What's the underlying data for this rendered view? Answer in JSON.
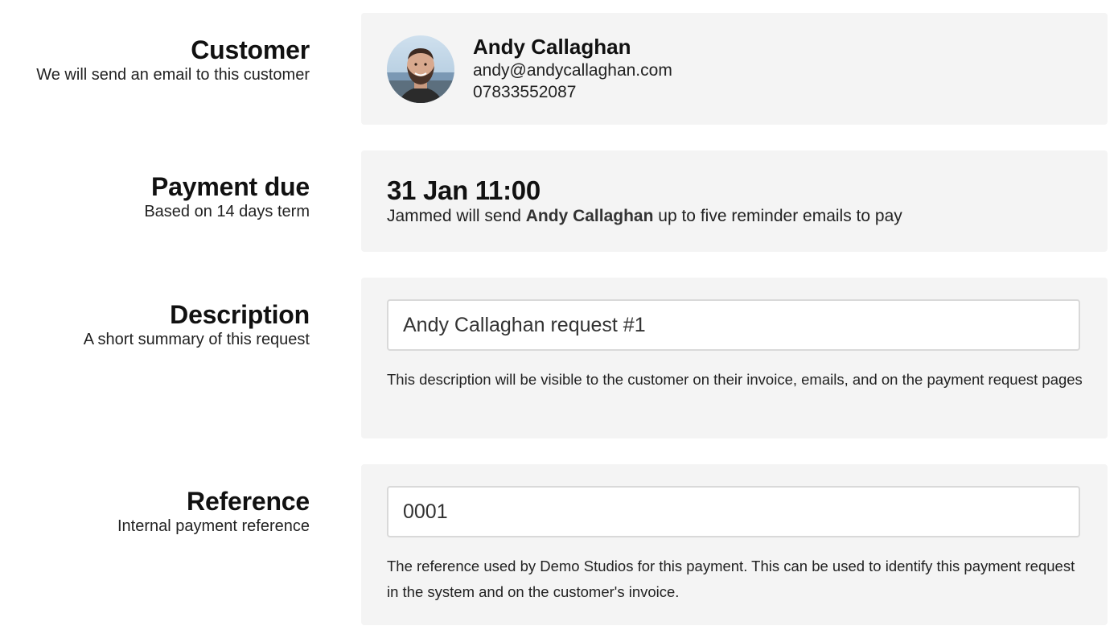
{
  "customer": {
    "title": "Customer",
    "subtitle": "We will send an email to this customer",
    "name": "Andy Callaghan",
    "email": "andy@andycallaghan.com",
    "phone": "07833552087"
  },
  "payment_due": {
    "title": "Payment due",
    "subtitle": "Based on 14 days term",
    "date": "31 Jan 11:00",
    "text_before": "Jammed will send ",
    "customer_name": "Andy Callaghan",
    "text_after": " up to five reminder emails to pay"
  },
  "description": {
    "title": "Description",
    "subtitle": "A short summary of this request",
    "value": "Andy Callaghan request #1",
    "help": "This description will be visible to the customer on their invoice, emails, and on the payment request pages"
  },
  "reference": {
    "title": "Reference",
    "subtitle": "Internal payment reference",
    "value": "0001",
    "help": "The reference used by Demo Studios for this payment. This can be used to identify this payment request in the system and on the customer's invoice."
  }
}
